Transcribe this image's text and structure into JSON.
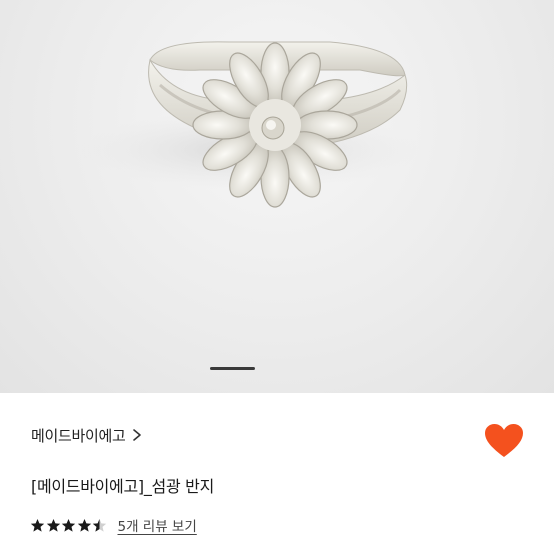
{
  "product": {
    "brand": "메이드바이에고",
    "title": "[메이드바이에고]_섬광 반지",
    "rating": 4.5,
    "rating_max": 5,
    "review_link": "5개 리뷰 보기",
    "wishlisted": true
  },
  "carousel": {
    "image_subject": "silver flower ring",
    "current_slide": 1
  },
  "icons": {
    "brand_chevron": "chevron-right-icon",
    "wishlist": "heart-icon",
    "rating": "star-icon"
  },
  "colors": {
    "heart": "#f4511e",
    "star": "#1a1a1a",
    "indicator": "#3a3a3a"
  }
}
